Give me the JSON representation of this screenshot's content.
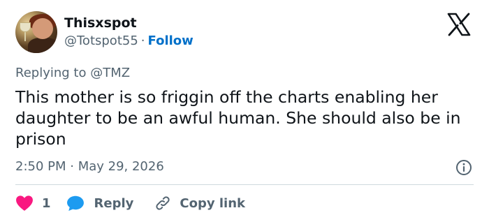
{
  "user": {
    "name": "Thisxspot",
    "handle": "@Totspot55",
    "separator": "·",
    "follow_label": "Follow"
  },
  "reply": {
    "prefix": "Replying to ",
    "mention": "@TMZ"
  },
  "tweet": {
    "text": "This mother is so friggin off the charts enabling her daughter to be an awful human. She should also be in prison",
    "timestamp": "2:50 PM · May 29, 2026"
  },
  "actions": {
    "like_count": "1",
    "reply_label": "Reply",
    "copy_label": "Copy link"
  },
  "icons": {
    "platform": "x-logo-icon",
    "info": "info-icon",
    "like": "heart-icon",
    "reply": "speech-bubble-icon",
    "copy": "link-icon"
  },
  "colors": {
    "text": "#0f1419",
    "secondary": "#536471",
    "follow": "#0070c9",
    "heart": "#f91880",
    "reply_bubble": "#1d9bf0",
    "divider": "#cfd9de"
  }
}
